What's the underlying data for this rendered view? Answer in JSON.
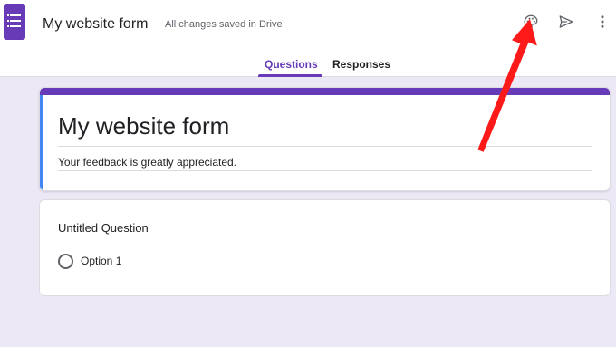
{
  "header": {
    "doc_title": "My website form",
    "save_status": "All changes saved in Drive",
    "icons": [
      "forms-logo-icon",
      "palette-icon",
      "send-icon",
      "more-vert-icon"
    ]
  },
  "tabs": [
    {
      "label": "Questions",
      "active": true
    },
    {
      "label": "Responses",
      "active": false
    }
  ],
  "form": {
    "title": "My website form",
    "description": "Your feedback is greatly appreciated.",
    "questions": [
      {
        "title": "Untitled Question",
        "options": [
          "Option 1"
        ]
      }
    ]
  },
  "colors": {
    "accent": "#673ab7",
    "left_accent": "#4285f4",
    "background": "#ece8f5",
    "annotation_arrow": "#ff1a1a"
  }
}
